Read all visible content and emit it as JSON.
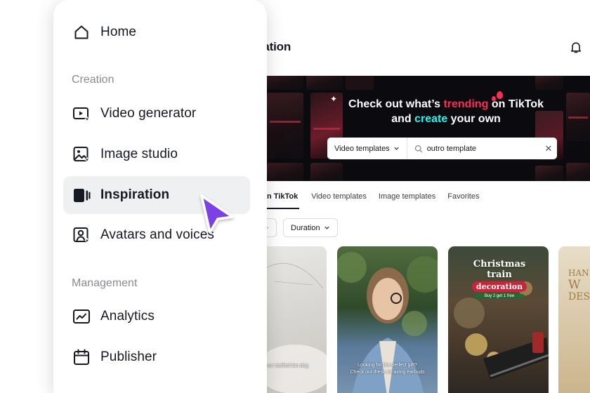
{
  "sidebar": {
    "home": "Home",
    "section_creation": "Creation",
    "video_generator": "Video generator",
    "image_studio": "Image studio",
    "inspiration": "Inspiration",
    "avatars_and_voices": "Avatars and voices",
    "section_management": "Management",
    "analytics": "Analytics",
    "publisher": "Publisher"
  },
  "header": {
    "title": "ration"
  },
  "banner": {
    "line1_pre": "Check out what’s ",
    "line1_hl": "trending",
    "line1_post": " on TikTok",
    "line2_pre": "and ",
    "line2_hl": "create",
    "line2_post": " your own",
    "search_type": "Video templates",
    "search_value": "outro template"
  },
  "tabs": [
    {
      "label": "n TikTok",
      "active": true
    },
    {
      "label": "Video templates",
      "active": false
    },
    {
      "label": "Image templates",
      "active": false
    },
    {
      "label": "Favorites",
      "active": false
    }
  ],
  "filters": {
    "duration": "Duration"
  },
  "cards": {
    "card1_caption": "n your stuffed lion dog",
    "card2_caption_1": "Looking for the perfect gift?",
    "card2_caption_2": "Check out these amazing earbuds",
    "card3_title_1": "Christmas train",
    "card3_title_2": "decoration",
    "card3_sub": "Buy 2 get 1 free",
    "card4_text_1": "HAN",
    "card4_text_2": "W",
    "card4_text_3": "DES"
  },
  "colors": {
    "accent_pink": "#fe2c55",
    "accent_cyan": "#25f4ee",
    "cursor_purple": "#7b3fe4",
    "active_bg": "#eff0f2"
  }
}
